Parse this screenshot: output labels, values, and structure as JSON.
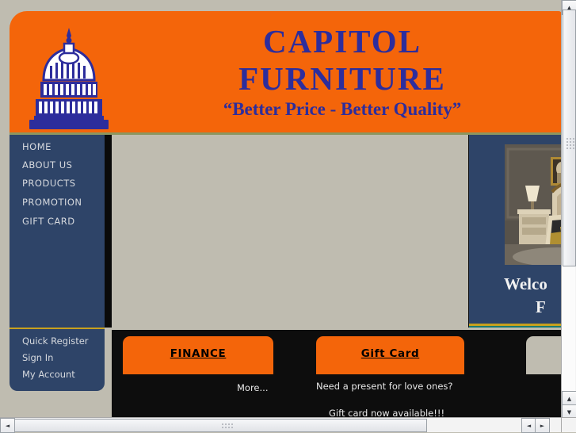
{
  "site": {
    "brand_line1": "CAPITOL",
    "brand_line2": "FURNITURE",
    "tagline": "“Better Price - Better Quality”",
    "logo_name": "capitol-dome-logo",
    "colors": {
      "orange": "#f4650a",
      "navy": "#2e4468",
      "brand_blue": "#2d2d9c",
      "content_beige": "#bfbcb0",
      "panel_black": "#0d0d0d",
      "gold_rule": "#c8a11e",
      "olive_rule": "#8c9660"
    }
  },
  "nav": {
    "items": [
      {
        "label": "HOME"
      },
      {
        "label": "ABOUT US"
      },
      {
        "label": "PRODUCTS"
      },
      {
        "label": "PROMOTION"
      },
      {
        "label": "GIFT CARD"
      }
    ]
  },
  "account": {
    "items": [
      {
        "label": "Quick Register"
      },
      {
        "label": "Sign In"
      },
      {
        "label": "My Account"
      }
    ]
  },
  "right_panel": {
    "image_name": "bedroom-furniture-photo",
    "welcome_line1": "Welco",
    "welcome_line2": "F"
  },
  "promos": [
    {
      "title": "FINANCE",
      "lines": [
        "More..."
      ]
    },
    {
      "title": "Gift Card",
      "lines": [
        "Need a present for love ones?",
        "Gift card now available!!!"
      ]
    }
  ],
  "scrollbars": {
    "vertical_up_arrow": "▲",
    "vertical_down_arrow": "▼",
    "horizontal_left_arrow": "◄",
    "horizontal_right_arrow": "►"
  }
}
